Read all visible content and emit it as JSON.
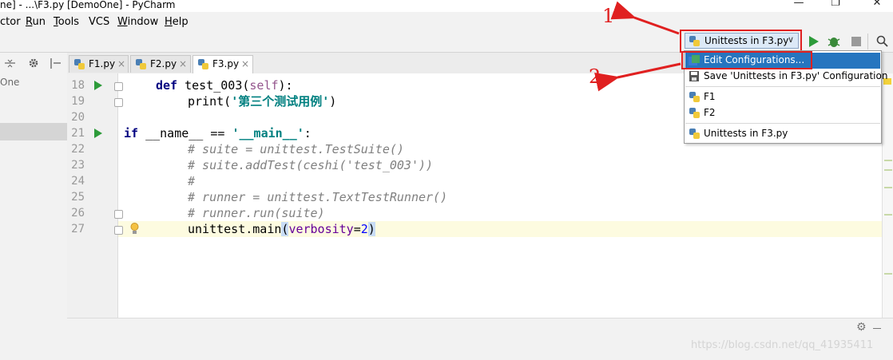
{
  "window": {
    "title": "ne] - ...\\F3.py [DemoOne] - PyCharm",
    "minimize_glyph": "—",
    "maximize_glyph": "❐",
    "close_glyph": "✕"
  },
  "menu": {
    "items": [
      {
        "label": "ctor",
        "mnemonic": ""
      },
      {
        "label": "Run",
        "mnemonic": "R"
      },
      {
        "label": "Tools",
        "mnemonic": "T"
      },
      {
        "label": "VCS",
        "mnemonic": ""
      },
      {
        "label": "Window",
        "mnemonic": "W"
      },
      {
        "label": "Help",
        "mnemonic": "H"
      }
    ]
  },
  "toolbar": {
    "run_config_label": "Unittests in F3.py",
    "chevron": "∨",
    "icons": [
      "run-icon",
      "debug-icon",
      "stop-icon",
      "search-icon"
    ]
  },
  "project": {
    "partial_name": "One"
  },
  "tabs": [
    {
      "label": "F1.py",
      "active": false
    },
    {
      "label": "F2.py",
      "active": false
    },
    {
      "label": "F3.py",
      "active": true
    }
  ],
  "editor": {
    "line_numbers": [
      "18",
      "19",
      "20",
      "21",
      "22",
      "23",
      "24",
      "25",
      "26",
      "27"
    ],
    "lines": {
      "l18_kw": "def",
      "l18_name": " test_003(",
      "l18_self": "self",
      "l18_end": "):",
      "l19_fn": "print(",
      "l19_str": "'第三个测试用例'",
      "l19_end": ")",
      "l21_kw": "if",
      "l21_a": " __name__ == ",
      "l21_str": "'__main__'",
      "l21_end": ":",
      "l22": "# suite = unittest.TestSuite()",
      "l23": "# suite.addTest(ceshi('test_003'))",
      "l24": "#",
      "l25": "# runner = unittest.TextTestRunner()",
      "l26": "# runner.run(suite)",
      "l27_a": "unittest.main",
      "l27_p1": "(",
      "l27_param": "verbosity",
      "l27_eq": "=",
      "l27_num": "2",
      "l27_p2": ")"
    }
  },
  "dropdown": {
    "items": [
      {
        "label": "Edit Configurations...",
        "selected": true
      },
      {
        "label": "Save 'Unittests in F3.py' Configuration",
        "selected": false
      },
      {
        "label": "F1",
        "selected": false
      },
      {
        "label": "F2",
        "selected": false
      },
      {
        "label": "Unittests in F3.py",
        "selected": false
      }
    ]
  },
  "annotations": {
    "one": "1",
    "two": "2",
    "color": "#e02020"
  },
  "watermark": "https://blog.csdn.net/qq_41935411"
}
